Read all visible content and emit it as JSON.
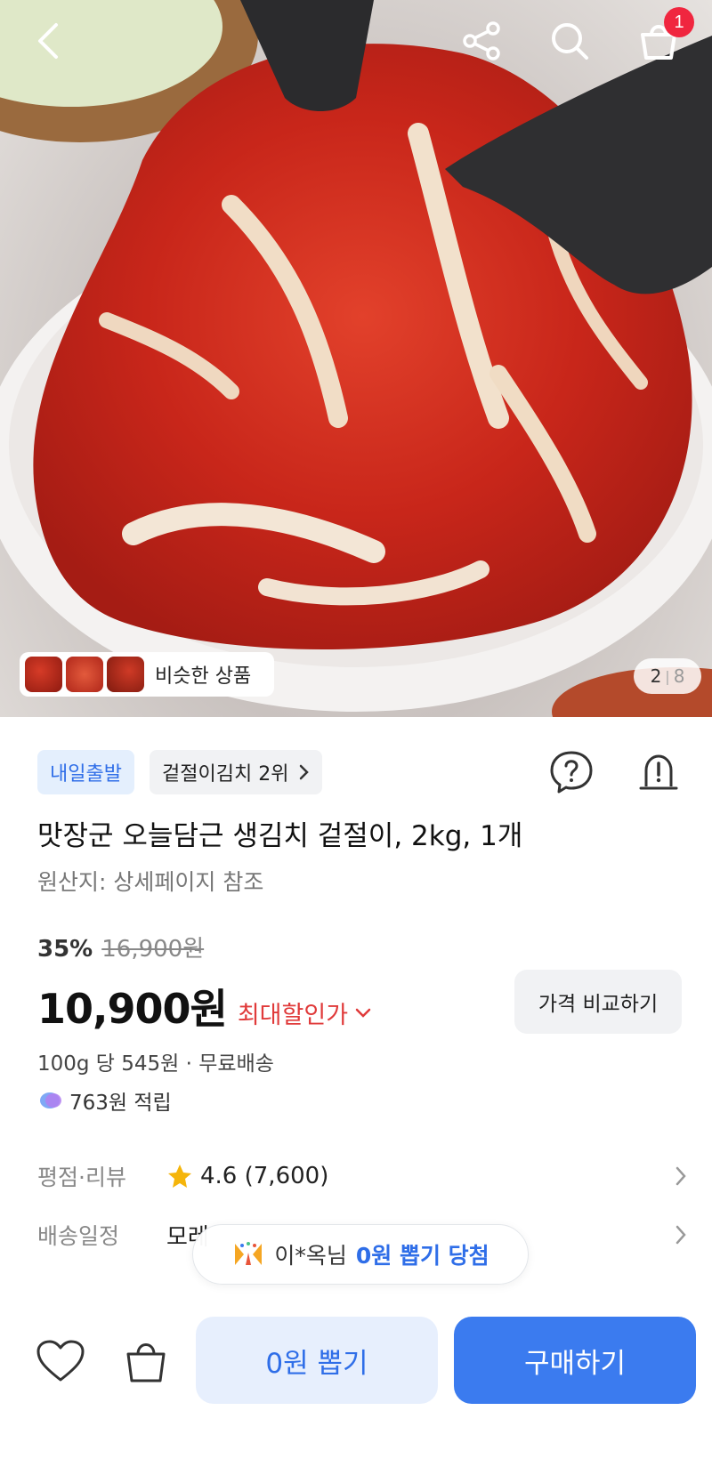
{
  "header": {
    "back_icon": "chevron-left-icon",
    "share_icon": "share-icon",
    "search_icon": "search-icon",
    "cart_icon": "cart-icon",
    "cart_badge": "1"
  },
  "gallery": {
    "similar_label": "비슷한 상품",
    "pager_current": "2",
    "pager_total": "8"
  },
  "product": {
    "badge_delivery": "내일출발",
    "ranking_chip": "겉절이김치 2위",
    "title": "맛장군 오늘담근 생김치 겉절이, 2kg, 1개",
    "origin": "원산지: 상세페이지 참조",
    "discount_percent": "35%",
    "original_price": "16,900원",
    "price": "10,900원",
    "max_discount_label": "최대할인가",
    "compare_label": "가격 비교하기",
    "unit_price": "100g 당 545원 · 무료배송",
    "points": "763원 적립"
  },
  "details": {
    "rating_label": "평점·리뷰",
    "rating_value": "4.6 (7,600)",
    "delivery_label": "배송일정",
    "delivery_value": "모레"
  },
  "toast": {
    "winner": "이*옥님",
    "prize": "0원 뽑기 당첨"
  },
  "bottom_bar": {
    "wish_icon": "heart-icon",
    "bag_icon": "shopping-bag-icon",
    "draw_label": "0원 뽑기",
    "buy_label": "구매하기"
  },
  "colors": {
    "accent_blue": "#3b7bef",
    "discount_red": "#e03a3a",
    "badge_red": "#f0263f"
  }
}
